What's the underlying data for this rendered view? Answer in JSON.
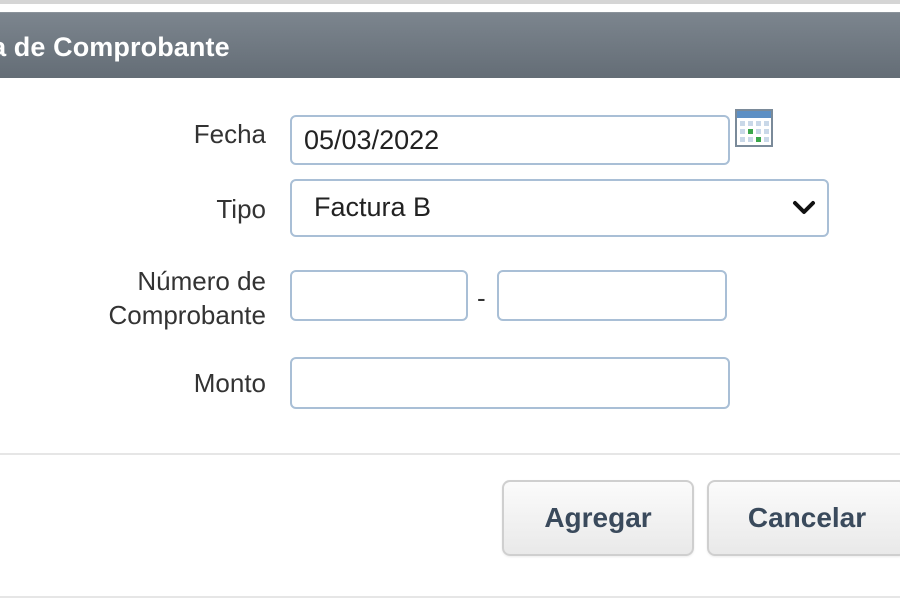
{
  "dialog": {
    "title": "ta de Comprobante"
  },
  "form": {
    "fecha": {
      "label": "Fecha",
      "value": "05/03/2022",
      "calendar_icon": "calendar-icon"
    },
    "tipo": {
      "label": "Tipo",
      "selected": "Factura B",
      "chevron_icon": "chevron-down-icon"
    },
    "numero": {
      "label_line1": "Número de",
      "label_line2": "Comprobante",
      "prefix_value": "",
      "separator": "-",
      "number_value": ""
    },
    "monto": {
      "label": "Monto",
      "value": ""
    }
  },
  "buttons": {
    "agregar": "Agregar",
    "cancelar": "Cancelar"
  },
  "colors": {
    "title_bar": "#6e777f",
    "input_border": "#a9bfd6",
    "button_text": "#3a4a5c"
  }
}
